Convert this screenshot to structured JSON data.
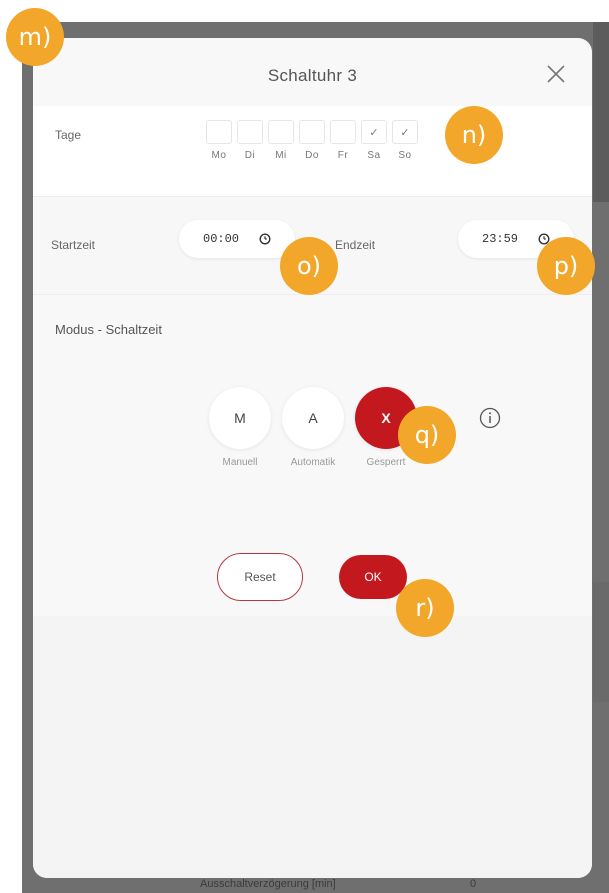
{
  "backdrop": {
    "bottom_text": "Ausschaltverzögerung [min]",
    "bottom_value": "0"
  },
  "dialog": {
    "title": "Schaltuhr 3",
    "close_icon": "close-icon"
  },
  "days": {
    "label": "Tage",
    "items": [
      {
        "label": "Mo",
        "checked": false,
        "mark": ""
      },
      {
        "label": "Di",
        "checked": false,
        "mark": ""
      },
      {
        "label": "Mi",
        "checked": false,
        "mark": ""
      },
      {
        "label": "Do",
        "checked": false,
        "mark": ""
      },
      {
        "label": "Fr",
        "checked": false,
        "mark": ""
      },
      {
        "label": "Sa",
        "checked": true,
        "mark": "✓"
      },
      {
        "label": "So",
        "checked": true,
        "mark": "✓"
      }
    ]
  },
  "times": {
    "start_label": "Startzeit",
    "start_value": "00:00",
    "end_label": "Endzeit",
    "end_value": "23:59",
    "clock_icon": "clock-icon"
  },
  "mode": {
    "title": "Modus - Schaltzeit",
    "buttons": [
      {
        "symbol": "M",
        "caption": "Manuell",
        "active": false
      },
      {
        "symbol": "A",
        "caption": "Automatik",
        "active": false
      },
      {
        "symbol": "X",
        "caption": "Gesperrt",
        "active": true
      }
    ],
    "info_icon": "info-icon"
  },
  "actions": {
    "reset_label": "Reset",
    "ok_label": "OK"
  },
  "annotations": {
    "m": "m)",
    "n": "n)",
    "o": "o)",
    "p": "p)",
    "q": "q)",
    "r": "r)"
  },
  "colors": {
    "accent_red": "#c4181f",
    "badge_orange": "#f2a72a",
    "backdrop": "#6f6f6f"
  }
}
